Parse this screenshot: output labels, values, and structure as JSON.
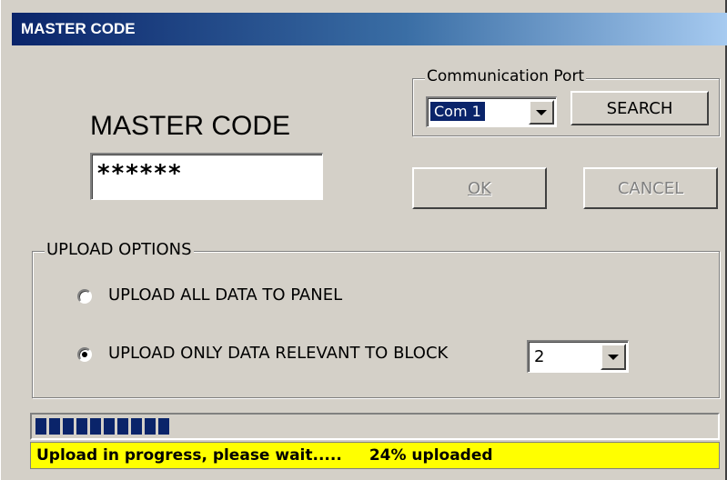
{
  "window": {
    "title": "MASTER CODE"
  },
  "master_code": {
    "heading": "MASTER CODE",
    "value": "******"
  },
  "comm_port": {
    "legend": "Communication Port",
    "selected": "Com 1",
    "search_label": "SEARCH"
  },
  "buttons": {
    "ok_label": "OK",
    "cancel_label": "CANCEL"
  },
  "upload_options": {
    "legend": "UPLOAD OPTIONS",
    "option_all": "UPLOAD ALL DATA TO PANEL",
    "option_block": "UPLOAD ONLY DATA RELEVANT TO BLOCK",
    "selected_option": "option_block",
    "block_value": "2"
  },
  "progress": {
    "status_text": "Upload in progress, please wait.....",
    "percent_text": "24% uploaded",
    "fraction": 0.24,
    "block_count": 10
  },
  "colors": {
    "title_bar": "#0a246a",
    "progress_block": "#0a246a",
    "status_background": "#ffff00",
    "face": "#d4d0c8"
  }
}
